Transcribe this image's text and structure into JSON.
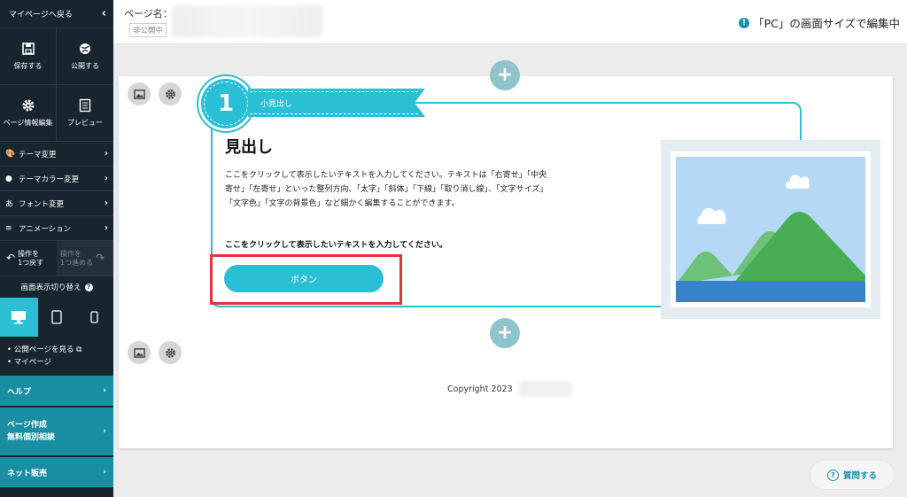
{
  "sidebar": {
    "back_label": "マイページへ戻る",
    "tiles": [
      {
        "label": "保存する",
        "icon": "save-icon"
      },
      {
        "label": "公開する",
        "icon": "publish-icon"
      },
      {
        "label": "ページ情報編集",
        "icon": "gear-icon"
      },
      {
        "label": "プレビュー",
        "icon": "preview-icon"
      }
    ],
    "menu": [
      {
        "label": "テーマ変更",
        "icon": "palette-icon"
      },
      {
        "label": "テーマカラー変更",
        "icon": "color-icon"
      },
      {
        "label": "フォント変更",
        "icon": "font-icon"
      },
      {
        "label": "アニメーション",
        "icon": "animation-icon"
      }
    ],
    "undo_label": "操作を\n1つ戻す",
    "redo_label": "操作を\n1つ進める",
    "switch_title": "画面表示切り替え",
    "links": [
      "公開ページを見る",
      "マイページ"
    ],
    "help_label": "ヘルプ",
    "consult_label_1": "ページ作成",
    "consult_label_2": "無料個別相談",
    "sales_label": "ネット販売"
  },
  "header": {
    "page_name_label": "ページ名：",
    "status": "非公開中",
    "edit_mode": "「PC」の画面サイズで編集中"
  },
  "content": {
    "badge_number": "1",
    "ribbon_label": "小見出し",
    "heading": "見出し",
    "body": "ここをクリックして表示したいテキストを入力してください。テキストは「右寄せ」「中央寄せ」「左寄せ」といった整列方向、「太字」「斜体」「下線」「取り消し線」、「文字サイズ」「文字色」「文字の背景色」など細かく編集することができます。",
    "bold_line": "ここをクリックして表示したいテキストを入力してください。",
    "button_label": "ボタン",
    "copyright": "Copyright 2023"
  },
  "ask_label": "質問する",
  "colors": {
    "accent": "#2abfd4",
    "sidebar_bg": "#17252f",
    "sidebar_teal": "#1a8fa3",
    "highlight": "#e3343d"
  }
}
